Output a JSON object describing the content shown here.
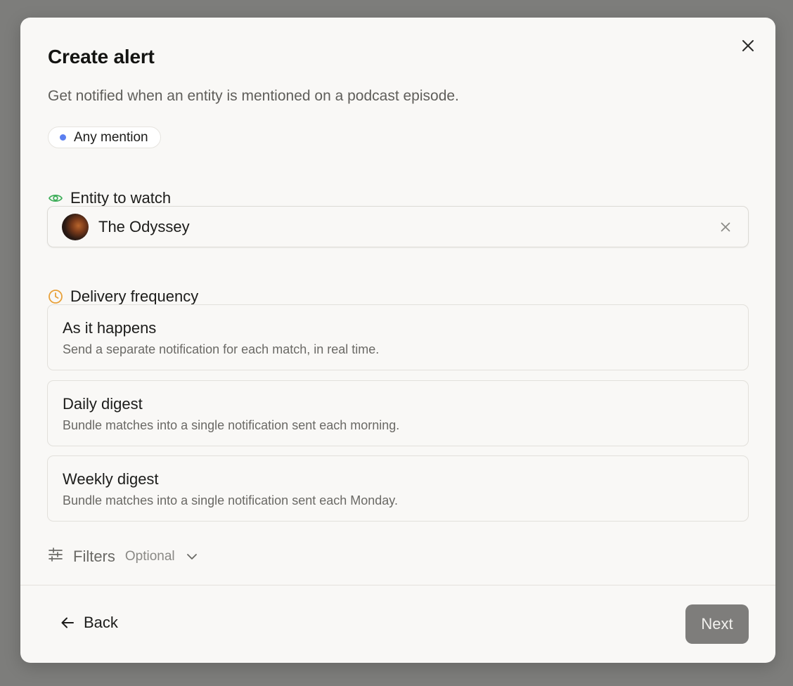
{
  "modal": {
    "title": "Create alert",
    "subtitle": "Get notified when an entity is mentioned on a podcast episode.",
    "close_icon": "close-icon"
  },
  "mention_chip": {
    "label": "Any mention",
    "dot_color": "#5b7ff0"
  },
  "entity_section": {
    "label": "Entity to watch",
    "icon": "eye-icon",
    "icon_color": "#3fae5a",
    "selected_entity": "The Odyssey",
    "clear_icon": "close-icon"
  },
  "frequency_section": {
    "label": "Delivery frequency",
    "icon": "clock-icon",
    "icon_color": "#e8a13a",
    "options": [
      {
        "title": "As it happens",
        "description": "Send a separate notification for each match, in real time."
      },
      {
        "title": "Daily digest",
        "description": "Bundle matches into a single notification sent each morning."
      },
      {
        "title": "Weekly digest",
        "description": "Bundle matches into a single notification sent each Monday."
      }
    ]
  },
  "filters": {
    "label": "Filters",
    "optional_label": "Optional",
    "icon": "sliders-icon"
  },
  "footer": {
    "back_label": "Back",
    "next_label": "Next"
  }
}
